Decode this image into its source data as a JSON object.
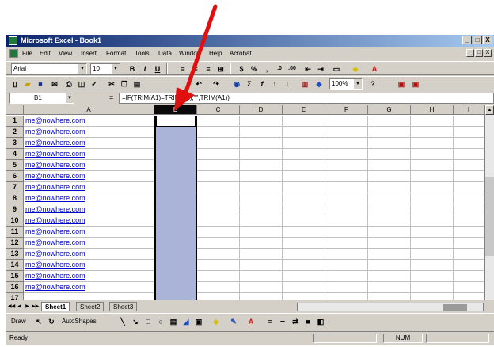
{
  "window": {
    "title": "Microsoft Excel - Book1",
    "buttons": [
      "_",
      "□",
      "X"
    ]
  },
  "menubar": {
    "items": [
      "File",
      "Edit",
      "View",
      "Insert",
      "Format",
      "Tools",
      "Data",
      "Window",
      "Help",
      "Acrobat"
    ],
    "doc_buttons": [
      "_",
      "□",
      "X"
    ]
  },
  "formatting_toolbar": {
    "font": "Arial",
    "size": "10",
    "bold": "B",
    "italic": "I",
    "underline": "U",
    "currency": "$",
    "percent": "%"
  },
  "standard_toolbar": {
    "zoom": "100%"
  },
  "formula_bar": {
    "name_box": "B1",
    "fx": "=",
    "formula": "=IF(TRIM(A1)=TRIM(A2),\"\",TRIM(A1))"
  },
  "sheet": {
    "columns": [
      "A",
      "B",
      "C",
      "D",
      "E",
      "F",
      "G",
      "H",
      "I"
    ],
    "selected_column": "B",
    "rows": [
      "1",
      "2",
      "3",
      "4",
      "5",
      "6",
      "7",
      "8",
      "9",
      "10",
      "11",
      "12",
      "13",
      "14",
      "15",
      "16",
      "17"
    ],
    "colA": [
      "me@nowhere.com",
      "me@nowhere.com",
      "me@nowhere.com",
      "me@nowhere.com",
      "me@nowhere.com",
      "me@nowhere.com",
      "me@nowhere.com",
      "me@nowhere.com",
      "me@nowhere.com",
      "me@nowhere.com",
      "me@nowhere.com",
      "me@nowhere.com",
      "me@nowhere.com",
      "me@nowhere.com",
      "me@nowhere.com",
      "me@nowhere.com"
    ]
  },
  "tabs": [
    "Sheet1",
    "Sheet2",
    "Sheet3"
  ],
  "drawing_toolbar": {
    "draw": "Draw",
    "autoshapes": "AutoShapes"
  },
  "status": {
    "left": "Ready",
    "num": "NUM"
  },
  "colors": {
    "annotation_arrow": "#e01010",
    "selection_fill": "#aab4d8",
    "link": "#0000cc"
  }
}
